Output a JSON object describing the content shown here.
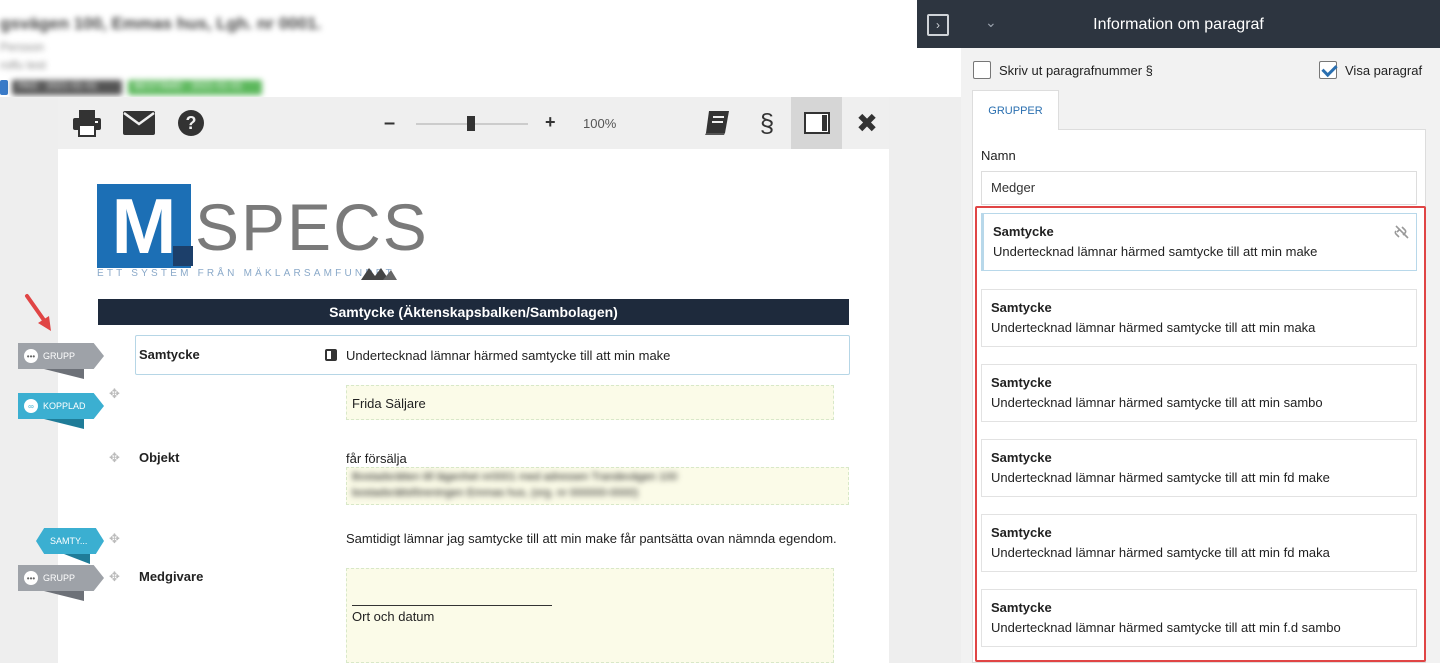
{
  "top": {
    "title": "gsvägen 100, Emmas hus, Lgh. nr 0001.",
    "sub1": "Persson",
    "sub2": "rolfu test",
    "chip_dark": "PAS · 2021-01-01",
    "chip_green": "BESTÄMD · 2021-01-01"
  },
  "toolbar": {
    "print_icon": "print-icon",
    "mail_icon": "envelope-icon",
    "help_icon": "question-icon",
    "zoom_minus": "–",
    "zoom_plus": "+",
    "zoom_value": "100%",
    "zoom_level": 0.5,
    "book_icon": "book-icon",
    "paragraph_icon": "§",
    "panel_icon": "panel-icon",
    "close_icon": "✖"
  },
  "logo": {
    "m": "M",
    "specs": "SPECS",
    "tagline": "ETT SYSTEM FRÅN MÄKLARSAMFUNDET"
  },
  "document": {
    "section_title": "Samtycke (Äktenskapsbalken/Sambolagen)",
    "row1_label": "Samtycke",
    "row1_text": "Undertecknad lämnar härmed samtycke till att min make",
    "field1_value": "Frida Säljare",
    "row2_label": "Objekt",
    "row2_text": "får försälja",
    "field2_line1": "Bostadsrätten till lägenhet nr0001 med adressen Trandevägen 100",
    "field2_line2": "bostadsrättsföreningen Emmas hus, (org. nr 000000-0000)",
    "row3_text": "Samtidigt lämnar jag samtycke till att min make får pantsätta ovan nämnda egendom.",
    "row4_label": "Medgivare",
    "field4_text": "Ort och datum"
  },
  "tags": {
    "grupp1": "GRUPP",
    "kopplad": "KOPPLAD",
    "samty": "SAMTY...",
    "grupp2": "GRUPP"
  },
  "panel": {
    "title": "Information om paragraf",
    "print_para_label": "Skriv ut paragrafnummer §",
    "show_para_label": "Visa paragraf",
    "tab_label": "GRUPPER",
    "name_label": "Namn",
    "name_value": "Medger",
    "cards": [
      {
        "title": "Samtycke",
        "desc": "Undertecknad lämnar härmed samtycke till att min make"
      },
      {
        "title": "Samtycke",
        "desc": "Undertecknad lämnar härmed samtycke till att min maka"
      },
      {
        "title": "Samtycke",
        "desc": "Undertecknad lämnar härmed samtycke till att min sambo"
      },
      {
        "title": "Samtycke",
        "desc": "Undertecknad lämnar härmed samtycke till att min fd make"
      },
      {
        "title": "Samtycke",
        "desc": "Undertecknad lämnar härmed samtycke till att min fd maka"
      },
      {
        "title": "Samtycke",
        "desc": "Undertecknad lämnar härmed samtycke till att min f.d sambo"
      }
    ]
  },
  "colors": {
    "panel_header": "#2d3540",
    "highlight": "#e04545",
    "tag_blue": "#3bafd1",
    "tag_grey": "#9ea2a8",
    "logo_blue": "#1c6fb5"
  }
}
